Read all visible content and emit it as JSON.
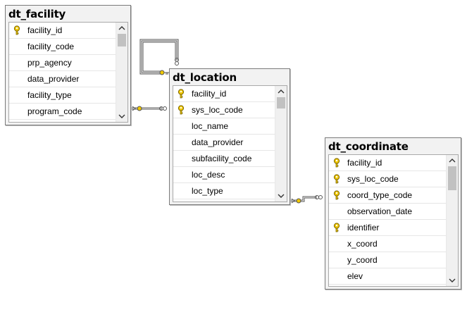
{
  "tables": [
    {
      "id": "dt_facility",
      "title": "dt_facility",
      "columns": [
        {
          "name": "facility_id",
          "key": true
        },
        {
          "name": "facility_code",
          "key": false
        },
        {
          "name": "prp_agency",
          "key": false
        },
        {
          "name": "data_provider",
          "key": false
        },
        {
          "name": "facility_type",
          "key": false
        },
        {
          "name": "program_code",
          "key": false
        }
      ]
    },
    {
      "id": "dt_location",
      "title": "dt_location",
      "columns": [
        {
          "name": "facility_id",
          "key": true
        },
        {
          "name": "sys_loc_code",
          "key": true
        },
        {
          "name": "loc_name",
          "key": false
        },
        {
          "name": "data_provider",
          "key": false
        },
        {
          "name": "subfacility_code",
          "key": false
        },
        {
          "name": "loc_desc",
          "key": false
        },
        {
          "name": "loc_type",
          "key": false
        }
      ]
    },
    {
      "id": "dt_coordinate",
      "title": "dt_coordinate",
      "columns": [
        {
          "name": "facility_id",
          "key": true
        },
        {
          "name": "sys_loc_code",
          "key": true
        },
        {
          "name": "coord_type_code",
          "key": true
        },
        {
          "name": "observation_date",
          "key": false
        },
        {
          "name": "identifier",
          "key": true
        },
        {
          "name": "x_coord",
          "key": false
        },
        {
          "name": "y_coord",
          "key": false
        },
        {
          "name": "elev",
          "key": false
        }
      ]
    }
  ],
  "colors": {
    "key_icon": "#f0c800",
    "relation_line": "#555555",
    "table_background": "#f2f2f2",
    "scroll_thumb": "#c1c1c1"
  }
}
